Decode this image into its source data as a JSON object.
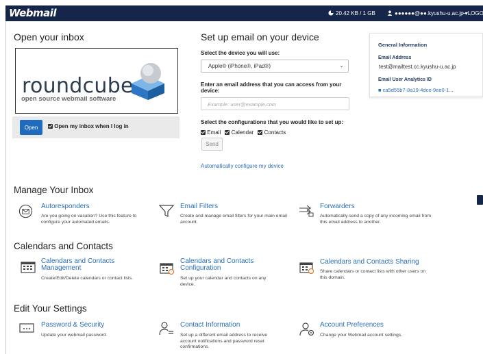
{
  "brand": "Webmail",
  "topbar": {
    "disk_usage": "20.42 KB / 1 GB",
    "user": "●●●●●●@●●.kyushu-u.ac.jp",
    "user_caret": "▾",
    "logout": "LOGOUT"
  },
  "open_inbox": {
    "title": "Open your inbox",
    "logo_word": "roundcube",
    "logo_tagline": "open source webmail software",
    "open_button": "Open",
    "remember_label": "Open my inbox when I log in"
  },
  "setup": {
    "title": "Set up email on your device",
    "device_label": "Select the device you will use:",
    "device_value": "Apple® (iPhone®, iPad®)",
    "email_label": "Enter an email address that you can access from your device:",
    "email_placeholder": "Example: user@example.com",
    "config_label": "Select the configurations that you would like to set up:",
    "config_options": [
      "Email",
      "Calendar",
      "Contacts"
    ],
    "send_button": "Send",
    "auto_link": "Automatically configure my device"
  },
  "general_info": {
    "title": "General Information",
    "email_label": "Email Address",
    "email_value": "test@mailtest.cc.kyushu-u.ac.jp",
    "analytics_label": "Email User Analytics ID",
    "analytics_value": "ca5d55b7-8a19-4dce-9ee0-1..."
  },
  "manage": {
    "title": "Manage Your Inbox",
    "items": [
      {
        "title": "Autoresponders",
        "desc": "Are you going on vacation? Use this feature to configure your automated emails.",
        "icon": "autoresponder-icon"
      },
      {
        "title": "Email Filters",
        "desc": "Create and manage email filters for your main email account.",
        "icon": "filter-icon"
      },
      {
        "title": "Forwarders",
        "desc": "Automatically send a copy of any incoming email from this email address to another.",
        "icon": "forwarder-icon"
      }
    ]
  },
  "calendars": {
    "title": "Calendars and Contacts",
    "items": [
      {
        "title": "Calendars and Contacts Management",
        "desc": "Create/Edit/Delete calendars or contact lists.",
        "icon": "calendar-icon"
      },
      {
        "title": "Calendars and Contacts Configuration",
        "desc": "Set up your calendar and contacts on any device.",
        "icon": "calendar-config-icon"
      },
      {
        "title": "Calendars and Contacts Sharing",
        "desc": "Share calendars or contact lists with other users on this domain.",
        "icon": "calendar-share-icon"
      }
    ]
  },
  "settings": {
    "title": "Edit Your Settings",
    "items": [
      {
        "title": "Password & Security",
        "desc": "Update your webmail password.",
        "icon": "password-icon"
      },
      {
        "title": "Contact Information",
        "desc": "Set up a different email address to receive account notifications and password reset confirmations.",
        "icon": "contact-icon"
      },
      {
        "title": "Account Preferences",
        "desc": "Change your Webmail account settings.",
        "icon": "preferences-icon"
      }
    ]
  },
  "colors": {
    "topbar": "#16264a",
    "link": "#2a6fb8",
    "primary_button": "#1f6bbd"
  }
}
